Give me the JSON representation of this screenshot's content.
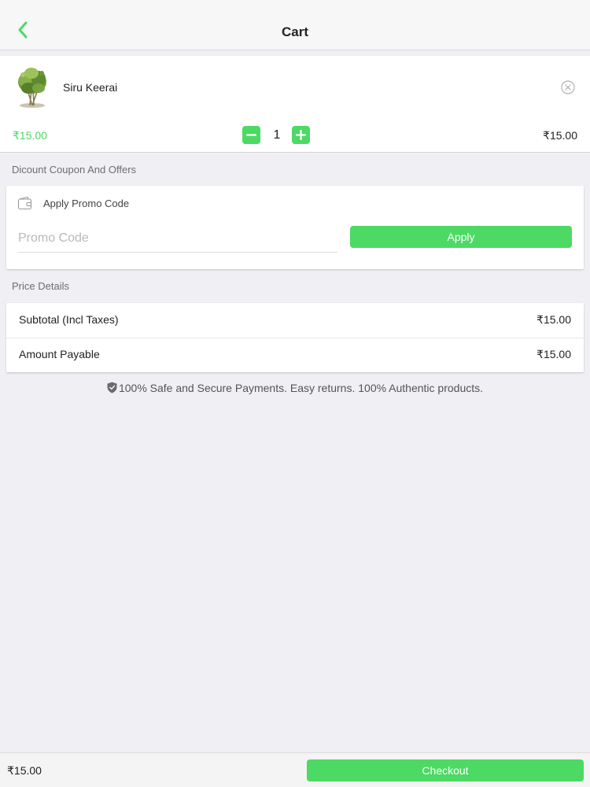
{
  "header": {
    "title": "Cart",
    "back_icon": "chevron-left-icon",
    "accent_color": "#4cd964"
  },
  "cart_item": {
    "name": "Siru Keerai",
    "unit_price": "₹15.00",
    "quantity": "1",
    "line_total": "₹15.00",
    "thumbnail_icon": "leafy-greens-image",
    "remove_icon": "close-circle-icon",
    "minus_icon": "minus-icon",
    "plus_icon": "plus-icon"
  },
  "coupon_section": {
    "header": "Dicount Coupon And Offers",
    "apply_promo_label": "Apply Promo Code",
    "promo_placeholder": "Promo Code",
    "promo_value": "",
    "apply_button": "Apply",
    "wallet_icon": "wallet-icon"
  },
  "price_details": {
    "header": "Price Details",
    "rows": [
      {
        "label": "Subtotal (Incl Taxes)",
        "value": "₹15.00"
      },
      {
        "label": "Amount Payable",
        "value": "₹15.00"
      }
    ]
  },
  "secure_note": {
    "icon": "shield-check-icon",
    "text": "100% Safe and Secure Payments. Easy returns. 100% Authentic products."
  },
  "bottom_bar": {
    "total": "₹15.00",
    "checkout_button": "Checkout"
  }
}
